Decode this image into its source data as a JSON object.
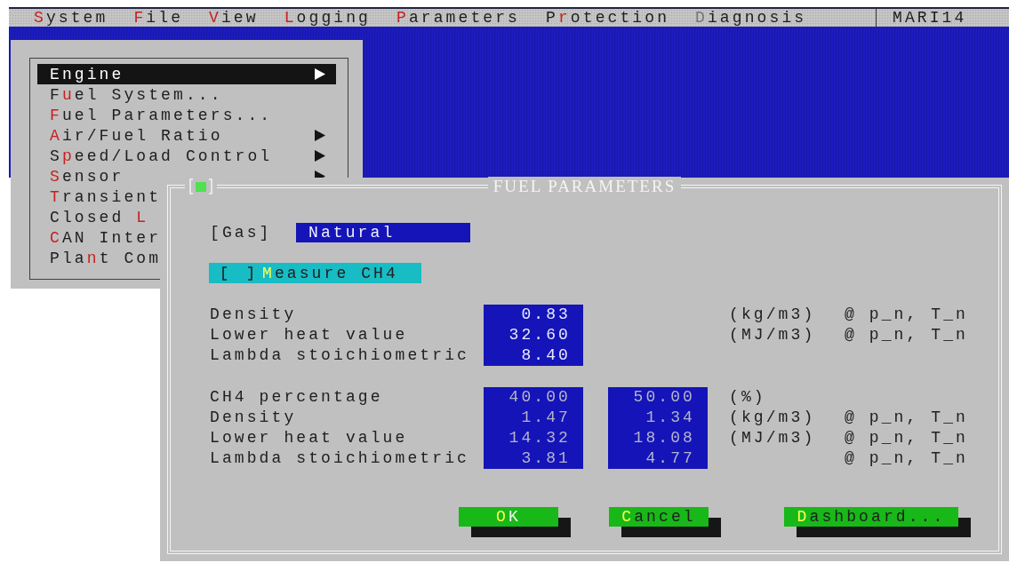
{
  "menubar": {
    "items": [
      {
        "label": "**S**ystem",
        "disabled": false
      },
      {
        "label": "**F**ile",
        "disabled": false
      },
      {
        "label": "**V**iew",
        "disabled": false
      },
      {
        "label": "**L**ogging",
        "disabled": false
      },
      {
        "label": "**P**arameters",
        "disabled": false
      },
      {
        "label": "P**r**otection",
        "disabled": false
      },
      {
        "label": "**D**iagnosis",
        "disabled": true
      }
    ],
    "station": "MARI14"
  },
  "menu": {
    "items": [
      {
        "label": "**E**ngine",
        "submenu": true,
        "selected": true
      },
      {
        "label": "F**u**el System...",
        "submenu": false,
        "selected": false
      },
      {
        "label": "**F**uel Parameters...",
        "submenu": false,
        "selected": false
      },
      {
        "label": "**A**ir/Fuel Ratio",
        "submenu": true,
        "selected": false
      },
      {
        "label": "S**p**eed/Load Control",
        "submenu": true,
        "selected": false
      },
      {
        "label": "**S**ensor",
        "submenu": true,
        "selected": false
      },
      {
        "label": "**T**ransient",
        "selected": false
      },
      {
        "label": "Closed **L**",
        "selected": false
      },
      {
        "label": "**C**AN Inter",
        "selected": false
      },
      {
        "label": "Pla**n**t Com",
        "selected": false
      }
    ]
  },
  "dialog": {
    "title": "FUEL PARAMETERS",
    "gas": {
      "label": "[Gas]",
      "value": "Natural"
    },
    "measure": {
      "label": "**M**easure CH4",
      "checked": false
    },
    "sections": [
      {
        "disabled": false,
        "rows": [
          {
            "label": "Density",
            "values": [
              "0.83"
            ],
            "unit": "(kg/m3)",
            "condition": "@ p_n, T_n"
          },
          {
            "label": "Lower heat value",
            "values": [
              "32.60"
            ],
            "unit": "(MJ/m3)",
            "condition": "@ p_n, T_n"
          },
          {
            "label": "Lambda stoichiometric",
            "values": [
              "8.40"
            ]
          }
        ]
      },
      {
        "disabled": true,
        "rows": [
          {
            "label": "CH4 percentage",
            "values": [
              "40.00",
              "50.00"
            ],
            "unit": "(%)"
          },
          {
            "label": "Density",
            "values": [
              "1.47",
              "1.34"
            ],
            "unit": "(kg/m3)",
            "condition": "@ p_n, T_n"
          },
          {
            "label": "Lower heat value",
            "values": [
              "14.32",
              "18.08"
            ],
            "unit": "(MJ/m3)",
            "condition": "@ p_n, T_n"
          },
          {
            "label": "Lambda stoichiometric",
            "values": [
              "3.81",
              "4.77"
            ],
            "condition": "@ p_n, T_n"
          }
        ]
      }
    ],
    "buttons": [
      {
        "label": "**O**K",
        "default": true
      },
      {
        "label": "**C**ancel",
        "default": false
      },
      {
        "label": "**D**ashboard...",
        "default": false
      }
    ]
  }
}
